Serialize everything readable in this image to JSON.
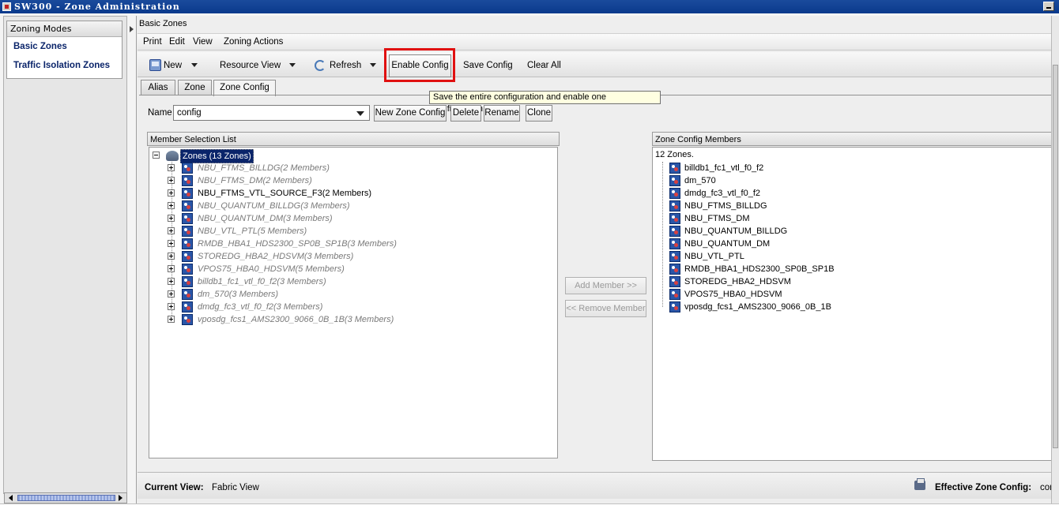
{
  "window": {
    "title": "SW300 - Zone Administration"
  },
  "left_panel": {
    "header": "Zoning Modes",
    "items": [
      "Basic Zones",
      "Traffic Isolation Zones"
    ]
  },
  "main": {
    "panel_title": "Basic Zones",
    "menu": [
      "Print",
      "Edit",
      "View",
      "Zoning Actions"
    ],
    "toolbar": {
      "new": "New",
      "resource_view": "Resource View",
      "refresh": "Refresh",
      "enable_config": "Enable Config",
      "save_config": "Save Config",
      "clear_all": "Clear All"
    },
    "tooltip": "Save the entire configuration and enable one configuration.",
    "tabs": [
      "Alias",
      "Zone",
      "Zone Config"
    ],
    "active_tab": "Zone Config",
    "name_label": "Name",
    "name_value": "config",
    "buttons": {
      "new_zone_config": "New Zone Config",
      "delete": "Delete",
      "rename": "Rename",
      "clone": "Clone"
    },
    "member_selection": {
      "header": "Member Selection List",
      "root": "Zones (13 Zones)",
      "zones": [
        "NBU_FTMS_BILLDG(2 Members)",
        "NBU_FTMS_DM(2 Members)",
        "NBU_FTMS_VTL_SOURCE_F3(2 Members)",
        "NBU_QUANTUM_BILLDG(3 Members)",
        "NBU_QUANTUM_DM(3 Members)",
        "NBU_VTL_PTL(5 Members)",
        "RMDB_HBA1_HDS2300_SP0B_SP1B(3 Members)",
        "STOREDG_HBA2_HDSVM(3 Members)",
        "VPOS75_HBA0_HDSVM(5 Members)",
        "billdb1_fc1_vtl_f0_f2(3 Members)",
        "dm_570(3 Members)",
        "dmdg_fc3_vtl_f0_f2(3 Members)",
        "vposdg_fcs1_AMS2300_9066_0B_1B(3 Members)"
      ]
    },
    "add_member": "Add Member >>",
    "remove_member": "<< Remove Member",
    "config_members": {
      "header": "Zone Config Members",
      "count": "12 Zones.",
      "items": [
        "billdb1_fc1_vtl_f0_f2",
        "dm_570",
        "dmdg_fc3_vtl_f0_f2",
        "NBU_FTMS_BILLDG",
        "NBU_FTMS_DM",
        "NBU_QUANTUM_BILLDG",
        "NBU_QUANTUM_DM",
        "NBU_VTL_PTL",
        "RMDB_HBA1_HDS2300_SP0B_SP1B",
        "STOREDG_HBA2_HDSVM",
        "VPOS75_HBA0_HDSVM",
        "vposdg_fcs1_AMS2300_9066_0B_1B"
      ]
    },
    "status": {
      "current_view_label": "Current View:",
      "current_view_value": "Fabric View",
      "effective_label": "Effective Zone Config:",
      "effective_value": "cor"
    }
  },
  "colors": {
    "accent": "#0a246a",
    "highlight": "#e01010",
    "tooltip_bg": "#ffffe1"
  }
}
